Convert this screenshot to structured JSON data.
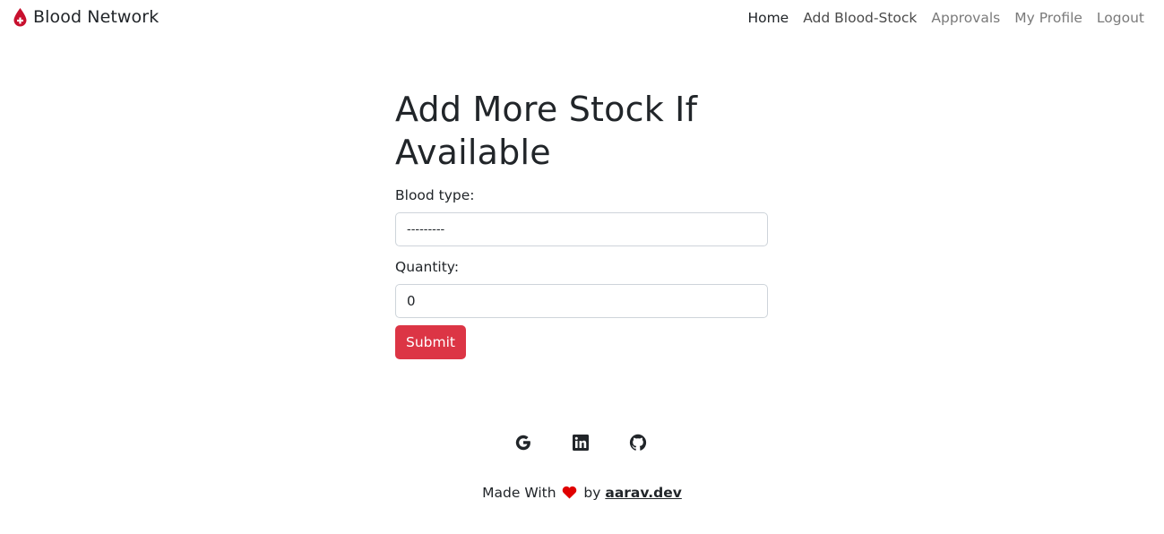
{
  "navbar": {
    "brand": "Blood Network",
    "links": [
      {
        "label": "Home"
      },
      {
        "label": "Add Blood-Stock"
      },
      {
        "label": "Approvals"
      },
      {
        "label": "My Profile"
      },
      {
        "label": "Logout"
      }
    ]
  },
  "form": {
    "title": "Add More Stock If Available",
    "blood_type_label": "Blood type:",
    "blood_type_value": "---------",
    "quantity_label": "Quantity:",
    "quantity_value": "0",
    "submit_label": "Submit"
  },
  "footer": {
    "social": [
      {
        "icon": "google-icon"
      },
      {
        "icon": "linkedin-icon"
      },
      {
        "icon": "github-icon"
      }
    ],
    "made_with": "Made With",
    "by": "by",
    "author": "aarav.dev"
  },
  "colors": {
    "accent": "#dc3545",
    "heart": "#e00000",
    "brand_drop": "#c8102e"
  }
}
